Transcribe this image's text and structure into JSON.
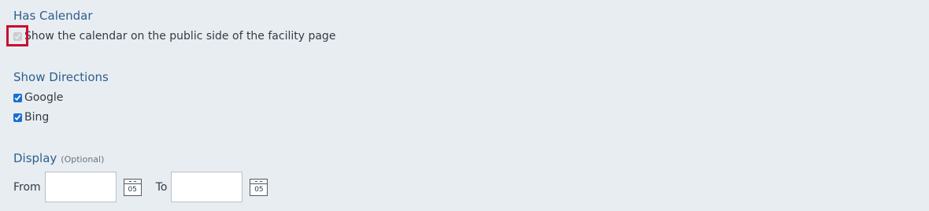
{
  "has_calendar": {
    "title": "Has Calendar",
    "checkbox_label": "Show the calendar on the public side of the facility page",
    "checked": true,
    "disabled": true
  },
  "show_directions": {
    "title": "Show Directions",
    "options": [
      {
        "label": "Google",
        "checked": true
      },
      {
        "label": "Bing",
        "checked": true
      }
    ]
  },
  "display": {
    "title": "Display",
    "optional_label": "(Optional)",
    "from_label": "From",
    "to_label": "To",
    "from_value": "",
    "to_value": "",
    "calendar_icon_day": "05"
  },
  "colors": {
    "background": "#e8edf2",
    "section_title": "#2d5f8c",
    "highlight": "#c8102e",
    "checkbox_accent": "#1a6fd1"
  },
  "icons": {
    "from_picker": "calendar-icon",
    "to_picker": "calendar-icon"
  }
}
